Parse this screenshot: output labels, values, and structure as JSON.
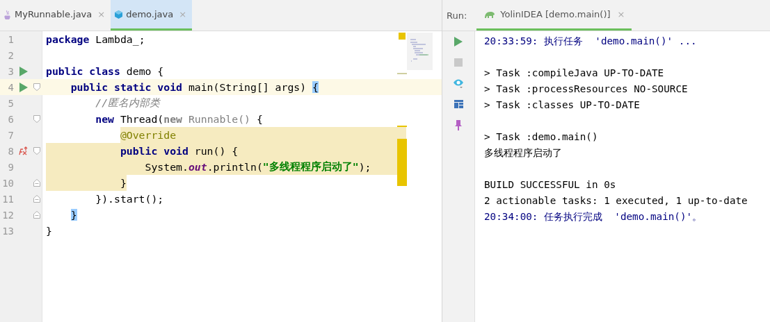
{
  "editor_tabs": [
    {
      "label": "MyRunnable.java",
      "selected": false,
      "close": "×"
    },
    {
      "label": "demo.java",
      "selected": true,
      "close": "×"
    }
  ],
  "code_lines": [
    {
      "number": "1",
      "tokens": [
        {
          "kind": "kw",
          "text": "package"
        },
        {
          "kind": "plain",
          "text": " Lambda_;"
        }
      ]
    },
    {
      "number": "2"
    },
    {
      "number": "3",
      "run": true,
      "tokens": [
        {
          "kind": "kw",
          "text": "public class"
        },
        {
          "kind": "plain",
          "text": " demo {"
        }
      ]
    },
    {
      "number": "4",
      "run": true,
      "fold_start": true,
      "current": true,
      "tokens": [
        {
          "kind": "kw",
          "text": "public static void"
        },
        {
          "kind": "plain",
          "text": " main(String[] args) "
        },
        {
          "kind": "match",
          "text": "{"
        }
      ]
    },
    {
      "number": "5",
      "tokens": [
        {
          "kind": "comment",
          "text": "//匿名内部类"
        }
      ]
    },
    {
      "number": "6",
      "fold_start": true,
      "tokens": [
        {
          "kind": "kw",
          "text": "new"
        },
        {
          "kind": "plain",
          "text": " Thread("
        },
        {
          "kind": "gray-kw",
          "text": "new"
        },
        {
          "kind": "gray",
          "text": " Runnable()"
        },
        {
          "kind": "plain",
          "text": " {"
        }
      ]
    },
    {
      "number": "7",
      "highlight_from_text": true,
      "tokens": [
        {
          "kind": "annotation",
          "text": "@Override"
        }
      ]
    },
    {
      "number": "8",
      "override": true,
      "fold_start": true,
      "highlighted": true,
      "tokens": [
        {
          "kind": "kw",
          "text": "public void"
        },
        {
          "kind": "plain",
          "text": " run() {"
        }
      ]
    },
    {
      "number": "9",
      "highlighted": true,
      "tokens": [
        {
          "kind": "plain",
          "text": "System."
        },
        {
          "kind": "static",
          "text": "out"
        },
        {
          "kind": "plain",
          "text": ".println("
        },
        {
          "kind": "string",
          "text": "\"多线程程序启动了\""
        },
        {
          "kind": "plain",
          "text": ");"
        }
      ]
    },
    {
      "number": "10",
      "fold_end": true,
      "highlight_to_text": true,
      "tokens": [
        {
          "kind": "plain",
          "text": "}"
        }
      ]
    },
    {
      "number": "11",
      "fold_end": true,
      "tokens": [
        {
          "kind": "plain",
          "text": "}).start();"
        }
      ]
    },
    {
      "number": "12",
      "fold_end": true,
      "tokens": [
        {
          "kind": "match",
          "text": "}"
        }
      ]
    },
    {
      "number": "13",
      "tokens": [
        {
          "kind": "plain",
          "text": "}"
        }
      ]
    }
  ],
  "run_panel": {
    "label": "Run:",
    "tab": {
      "label": "YolinIDEA [demo.main()]",
      "selected": true,
      "close": "×"
    }
  },
  "console_lines": [
    {
      "kind": "info",
      "text": "20:33:59: 执行任务  'demo.main()' ..."
    },
    {
      "kind": "plain",
      "space_before": true,
      "text": "> Task :compileJava UP-TO-DATE"
    },
    {
      "kind": "plain",
      "text": "> Task :processResources NO-SOURCE"
    },
    {
      "kind": "plain",
      "text": "> Task :classes UP-TO-DATE"
    },
    {
      "kind": "plain",
      "space_before": true,
      "text": "> Task :demo.main()"
    },
    {
      "kind": "plain",
      "text": "多线程程序启动了"
    },
    {
      "kind": "plain",
      "space_before": true,
      "text": "BUILD SUCCESSFUL in 0s"
    },
    {
      "kind": "plain",
      "text": "2 actionable tasks: 1 executed, 1 up-to-date"
    },
    {
      "kind": "info",
      "text": "20:34:00: 任务执行完成  'demo.main()'。"
    }
  ]
}
